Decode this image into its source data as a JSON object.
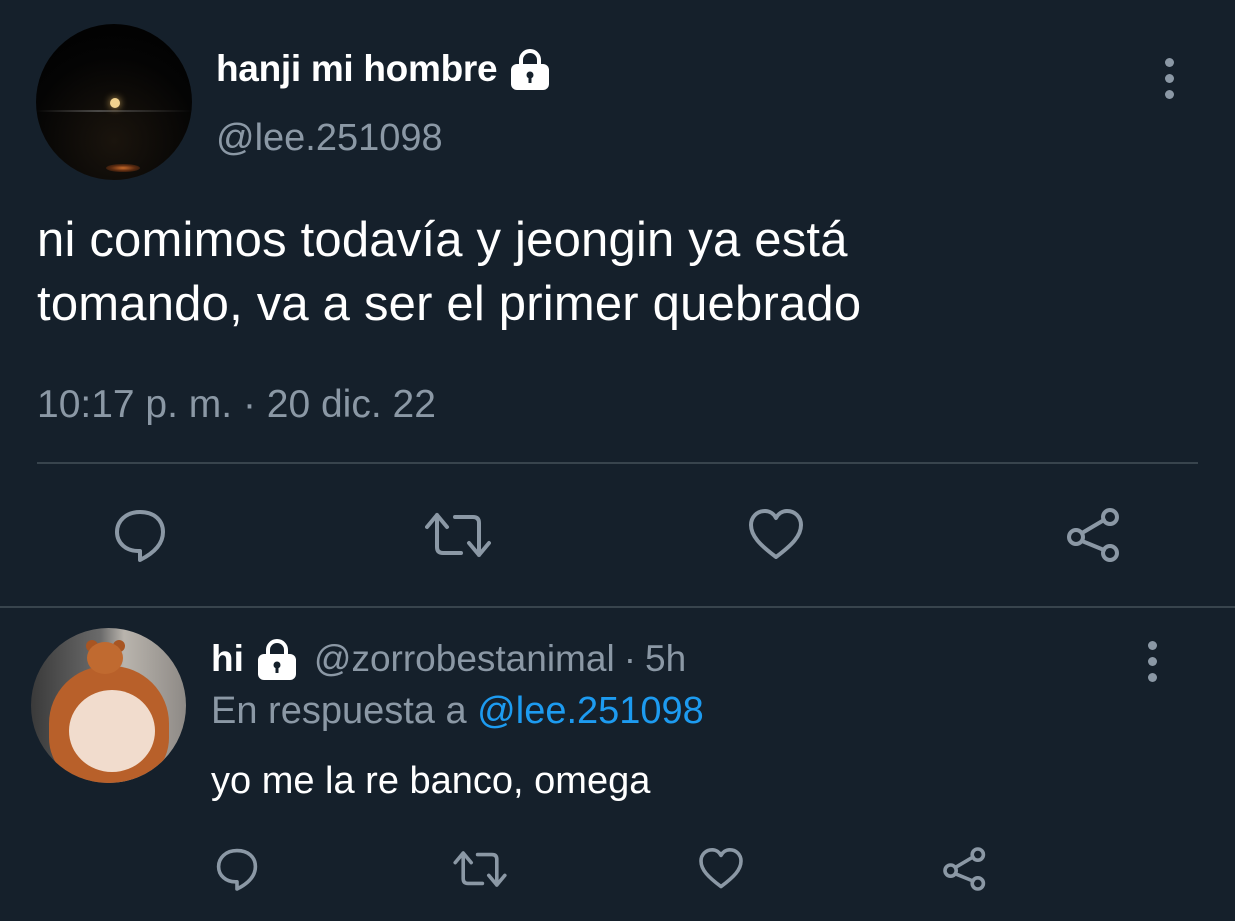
{
  "tweet": {
    "author_name": "hanji mi hombre",
    "author_handle": "@lee.251098",
    "text_line1": "ni comimos todavía y jeongin ya está",
    "text_line2": "tomando, va a ser el primer quebrado",
    "timestamp": "10:17 p. m. · 20 dic. 22",
    "icons": {
      "protected": "lock-icon",
      "more": "more-vertical-icon",
      "reply": "reply-bubble-icon",
      "retweet": "retweet-icon",
      "like": "heart-icon",
      "share": "share-icon"
    }
  },
  "reply": {
    "author_name": "hi",
    "author_handle": "@zorrobestanimal",
    "separator": "·",
    "age": "5h",
    "context_prefix": "En respuesta a",
    "context_mention": "@lee.251098",
    "text": "yo me la re banco, omega"
  },
  "colors": {
    "background": "#15202b",
    "text_primary": "#ffffff",
    "text_secondary": "#8b98a5",
    "divider": "#38444d",
    "link": "#1d9bf0"
  }
}
